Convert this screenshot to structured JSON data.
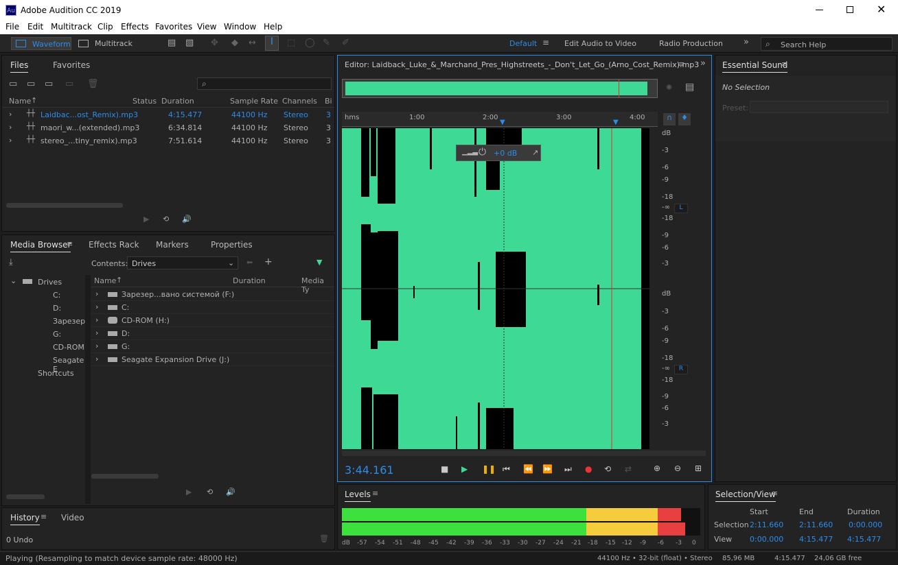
{
  "window": {
    "title": "Adobe Audition CC 2019",
    "app_icon": "Au"
  },
  "menu": [
    "File",
    "Edit",
    "Multitrack",
    "Clip",
    "Effects",
    "Favorites",
    "View",
    "Window",
    "Help"
  ],
  "toolbar": {
    "waveform": "Waveform",
    "multitrack": "Multitrack",
    "workspaces": [
      "Default",
      "Edit Audio to Video",
      "Radio Production"
    ],
    "search_placeholder": "Search Help"
  },
  "files_panel": {
    "tabs": [
      "Files",
      "Favorites"
    ],
    "columns": [
      "Name",
      "Status",
      "Duration",
      "Sample Rate",
      "Channels",
      "Bi"
    ],
    "rows": [
      {
        "name": "Laidbac...ost_Remix).mp3",
        "duration": "4:15.477",
        "rate": "44100 Hz",
        "channels": "Stereo",
        "bits": "3"
      },
      {
        "name": "maori_w...(extended).mp3",
        "duration": "6:34.814",
        "rate": "44100 Hz",
        "channels": "Stereo",
        "bits": "3"
      },
      {
        "name": "stereo_...tiny_remix).mp3",
        "duration": "7:51.614",
        "rate": "44100 Hz",
        "channels": "Stereo",
        "bits": "3"
      }
    ]
  },
  "media_panel": {
    "tabs": [
      "Media Browser",
      "Effects Rack",
      "Markers",
      "Properties"
    ],
    "contents_label": "Contents:",
    "contents_value": "Drives",
    "tree": [
      "Drives",
      "C:",
      "D:",
      "Зарезерв",
      "G:",
      "CD-ROM",
      "Seagate E",
      "Shortcuts"
    ],
    "columns": [
      "Name",
      "Duration",
      "Media Ty"
    ],
    "items": [
      "Зарезер...вано системой (F:)",
      "C:",
      "CD-ROM (H:)",
      "D:",
      "G:",
      "Seagate Expansion Drive (J:)"
    ]
  },
  "history_panel": {
    "tabs": [
      "History",
      "Video"
    ],
    "undo": "0 Undo"
  },
  "editor": {
    "title": "Editor: Laidback_Luke_&_Marchand_Pres_Highstreets_-_Don't_Let_Go_(Arno_Cost_Remix).mp3",
    "ruler": [
      "hms",
      "1:00",
      "2:00",
      "3:00",
      "4:00"
    ],
    "hud_gain": "+0 dB",
    "scale_top": [
      "dB",
      "-3",
      "-6",
      "-9",
      "-18",
      "-∞",
      "-18",
      "-9",
      "-6",
      "-3"
    ],
    "scale_bottom": [
      "dB",
      "-3",
      "-6",
      "-9",
      "-18",
      "-∞",
      "-18",
      "-9",
      "-6",
      "-3"
    ],
    "channel_l": "L",
    "channel_r": "R",
    "time": "3:44.161",
    "playhead_fraction": 0.877
  },
  "essential_sound": {
    "title": "Essential Sound",
    "no_selection": "No Selection",
    "preset_label": "Preset:"
  },
  "levels": {
    "title": "Levels",
    "scale": [
      "dB",
      "-57",
      "-54",
      "-51",
      "-48",
      "-45",
      "-42",
      "-39",
      "-36",
      "-33",
      "-30",
      "-27",
      "-24",
      "-21",
      "-18",
      "-15",
      "-12",
      "-9",
      "-6",
      "-3",
      "0"
    ]
  },
  "selection_view": {
    "title": "Selection/View",
    "headers": [
      "Start",
      "End",
      "Duration"
    ],
    "selection_label": "Selection",
    "view_label": "View",
    "selection": [
      "2:11.660",
      "2:11.660",
      "0:00.000"
    ],
    "view": [
      "0:00.000",
      "4:15.477",
      "4:15.477"
    ]
  },
  "status": {
    "left": "Playing (Resampling to match device sample rate: 48000 Hz)",
    "format": "44100 Hz • 32-bit (float) • Stereo",
    "size": "85,96 MB",
    "duration": "4:15.477",
    "free": "24,06 GB free"
  }
}
